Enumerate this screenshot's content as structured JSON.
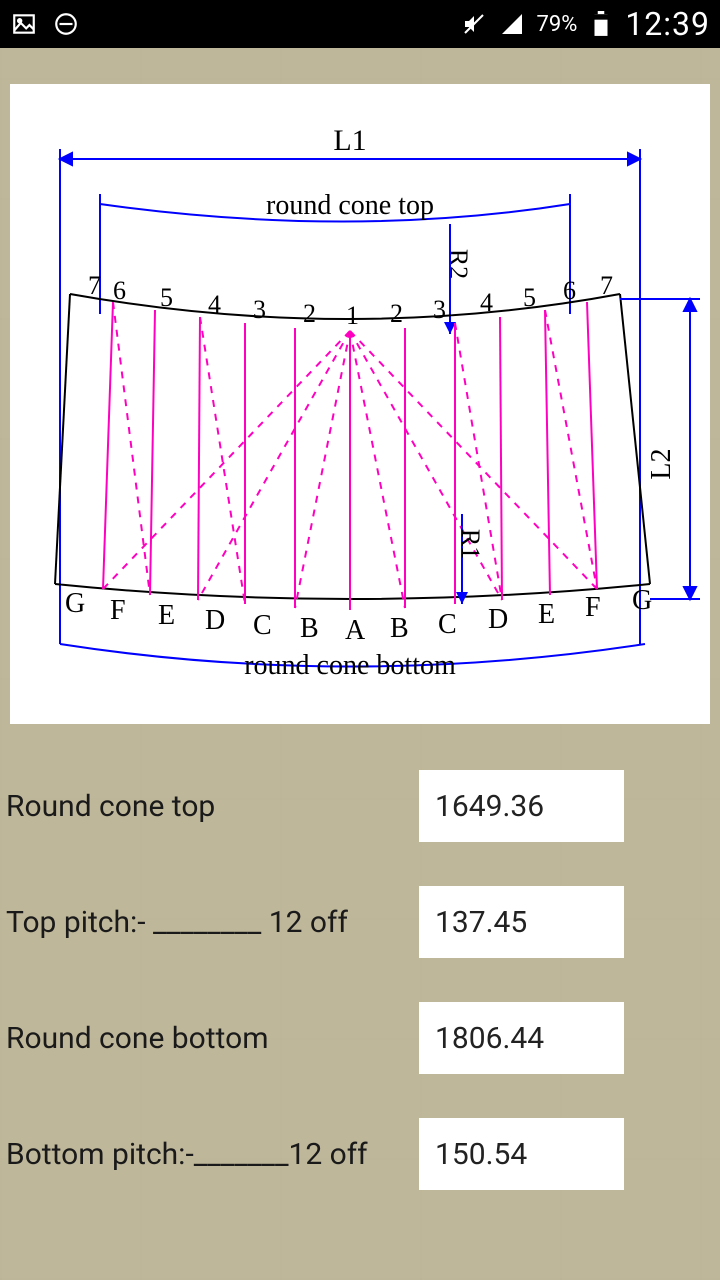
{
  "status": {
    "battery_pct": "79%",
    "time": "12:39"
  },
  "diagram": {
    "title_top": "round cone top",
    "title_bottom": "round cone bottom",
    "L1": "L1",
    "L2": "L2",
    "R1": "R1",
    "R2": "R2",
    "top_numbers_left": [
      "7",
      "6",
      "5",
      "4",
      "3",
      "2",
      "1"
    ],
    "top_numbers_right": [
      "2",
      "3",
      "4",
      "5",
      "6",
      "7"
    ],
    "bottom_letters_left": [
      "G",
      "F",
      "E",
      "D",
      "C",
      "B",
      "A"
    ],
    "bottom_letters_right": [
      "B",
      "C",
      "D",
      "E",
      "F",
      "G"
    ]
  },
  "results": [
    {
      "label": "Round cone top",
      "value": "1649.36"
    },
    {
      "label": "Top pitch:- ________ 12 off",
      "value": "137.45"
    },
    {
      "label": "Round cone bottom",
      "value": "1806.44"
    },
    {
      "label": "Bottom pitch:-_______12 off",
      "value": "150.54"
    }
  ]
}
